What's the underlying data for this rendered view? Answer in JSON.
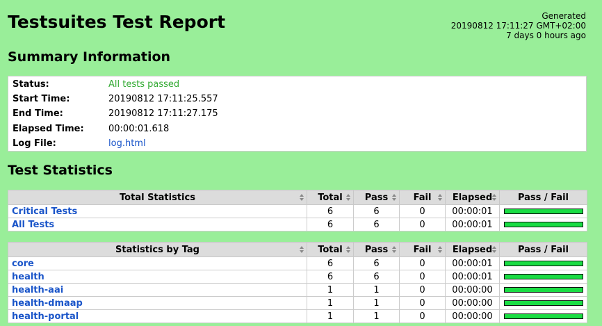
{
  "header": {
    "title": "Testsuites Test Report",
    "generated_label": "Generated",
    "generated_time": "20190812 17:11:27 GMT+02:00",
    "generated_ago": "7 days 0 hours ago"
  },
  "summary": {
    "title": "Summary Information",
    "rows": [
      {
        "label": "Status:",
        "value": "All tests passed"
      },
      {
        "label": "Start Time:",
        "value": "20190812 17:11:25.557"
      },
      {
        "label": "End Time:",
        "value": "20190812 17:11:27.175"
      },
      {
        "label": "Elapsed Time:",
        "value": "00:00:01.618"
      },
      {
        "label": "Log File:",
        "value": "log.html"
      }
    ]
  },
  "statistics": {
    "title": "Test Statistics",
    "columns": [
      "Total",
      "Pass",
      "Fail",
      "Elapsed",
      "Pass / Fail"
    ],
    "total": {
      "header": "Total Statistics",
      "rows": [
        {
          "name": "Critical Tests",
          "total": "6",
          "pass": "6",
          "fail": "0",
          "elapsed": "00:00:01",
          "pass_fraction": 1.0
        },
        {
          "name": "All Tests",
          "total": "6",
          "pass": "6",
          "fail": "0",
          "elapsed": "00:00:01",
          "pass_fraction": 1.0
        }
      ]
    },
    "tag": {
      "header": "Statistics by Tag",
      "rows": [
        {
          "name": "core",
          "total": "6",
          "pass": "6",
          "fail": "0",
          "elapsed": "00:00:01",
          "pass_fraction": 1.0
        },
        {
          "name": "health",
          "total": "6",
          "pass": "6",
          "fail": "0",
          "elapsed": "00:00:01",
          "pass_fraction": 1.0
        },
        {
          "name": "health-aai",
          "total": "1",
          "pass": "1",
          "fail": "0",
          "elapsed": "00:00:00",
          "pass_fraction": 1.0
        },
        {
          "name": "health-dmaap",
          "total": "1",
          "pass": "1",
          "fail": "0",
          "elapsed": "00:00:00",
          "pass_fraction": 1.0
        },
        {
          "name": "health-portal",
          "total": "1",
          "pass": "1",
          "fail": "0",
          "elapsed": "00:00:00",
          "pass_fraction": 1.0
        }
      ]
    }
  },
  "colors": {
    "background": "#99ee99",
    "pass_bar": "#1add44",
    "link": "#1a55c9",
    "status_pass": "#33aa33"
  }
}
